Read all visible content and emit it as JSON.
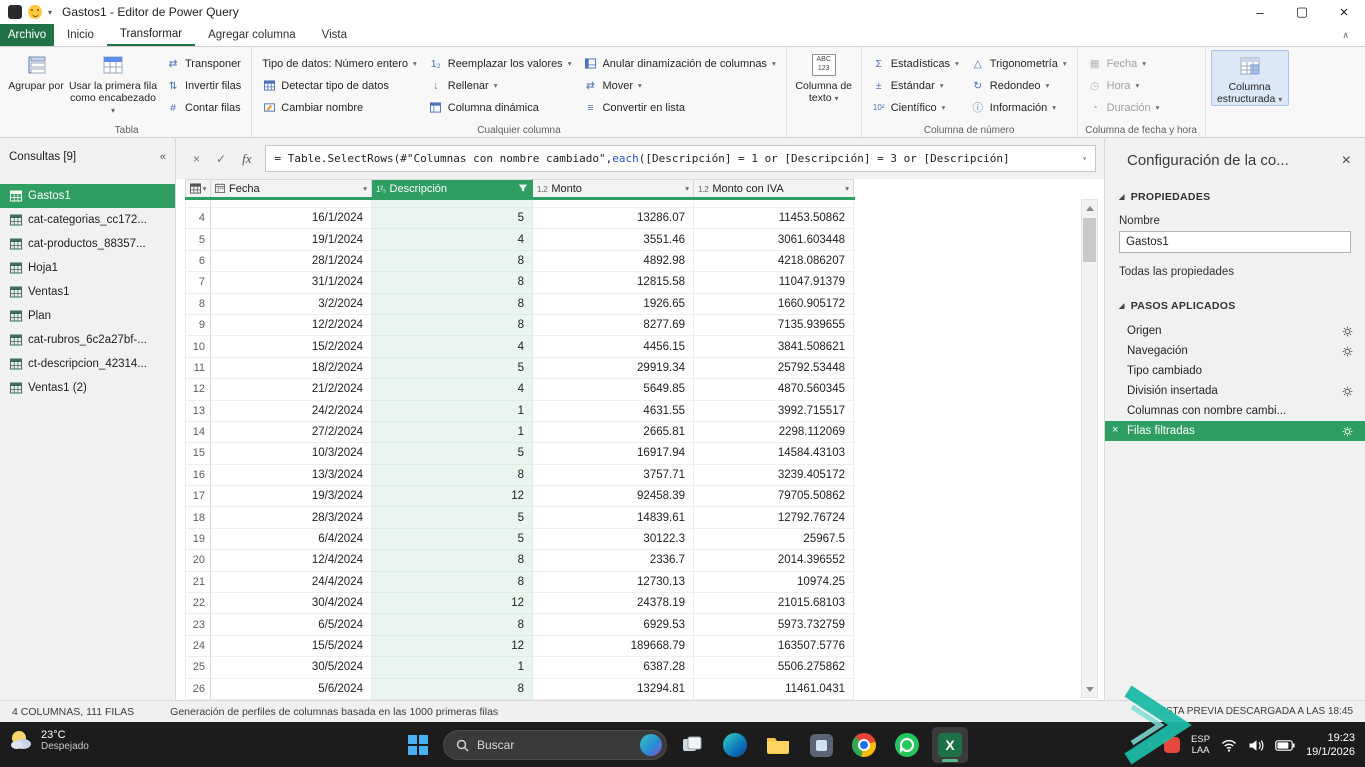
{
  "icons": {
    "dropdown": "▾",
    "collapse_queries": "«",
    "ribbon_collapse": "∧",
    "minimize": "–",
    "maximize": "▢",
    "close": "×",
    "cancel": "×",
    "check": "✓",
    "fx": "fx",
    "swap": "⇄",
    "updown": "⇅",
    "hash": "#",
    "sub12": "1₂",
    "fill": "↓",
    "list": "≡",
    "sigma": "Σ",
    "pm": "±",
    "sci": "10²",
    "tri": "△",
    "round": "↻",
    "info": "ⓘ",
    "cal": "▦",
    "clock": "◷",
    "dur": "◔",
    "type_whole": "1²₃",
    "type_decimal": "1.2",
    "tray_chevron": "∧"
  },
  "window": {
    "title": "Gastos1 - Editor de Power Query"
  },
  "ribbon_tabs": {
    "archivo": "Archivo",
    "inicio": "Inicio",
    "transformar": "Transformar",
    "agregar_columna": "Agregar columna",
    "vista": "Vista"
  },
  "ribbon": {
    "tabla": {
      "label": "Tabla",
      "agrupar_por": "Agrupar por",
      "primera_fila": "Usar la primera fila como encabezado",
      "transponer": "Transponer",
      "invertir_filas": "Invertir filas",
      "contar_filas": "Contar filas"
    },
    "cualquier_columna": {
      "label": "Cualquier columna",
      "tipo_datos": "Tipo de datos: Número entero",
      "detectar_tipo": "Detectar tipo de datos",
      "cambiar_nombre": "Cambiar nombre",
      "reemplazar_valores": "Reemplazar los valores",
      "rellenar": "Rellenar",
      "columna_dinamica": "Columna dinámica",
      "anular_dinamizacion": "Anular dinamización de columnas",
      "mover": "Mover",
      "convertir_lista": "Convertir en lista"
    },
    "columna_texto": {
      "label": "Columna de texto",
      "icon_top": "ABC",
      "icon_bottom": "123"
    },
    "columna_numero": {
      "label": "Columna de número",
      "estadisticas": "Estadísticas",
      "estandar": "Estándar",
      "cientifico": "Científico",
      "trigonometria": "Trigonometría",
      "redondeo": "Redondeo",
      "informacion": "Información"
    },
    "fecha_hora": {
      "label": "Columna de fecha y hora",
      "fecha": "Fecha",
      "hora": "Hora",
      "duracion": "Duración"
    },
    "estructurada": {
      "label": "Columna estructurada"
    }
  },
  "sidebar": {
    "header": "Consultas [9]",
    "items": [
      {
        "label": "Gastos1",
        "selected": true
      },
      {
        "label": "cat-categorias_cc172..."
      },
      {
        "label": "cat-productos_88357..."
      },
      {
        "label": "Hoja1"
      },
      {
        "label": "Ventas1"
      },
      {
        "label": "Plan"
      },
      {
        "label": "cat-rubros_6c2a27bf-..."
      },
      {
        "label": "ct-descripcion_42314..."
      },
      {
        "label": "Ventas1 (2)"
      }
    ]
  },
  "formula_bar": {
    "part1": "= Table.SelectRows(#\"Columnas con nombre cambiado\", ",
    "keyword": "each",
    "part2": " ([Descripción] = 1 or [Descripción] = 3 or [Descripción]"
  },
  "table": {
    "columns": [
      {
        "name": "Fecha"
      },
      {
        "name": "Descripción",
        "selected": true,
        "filtered": true
      },
      {
        "name": "Monto"
      },
      {
        "name": "Monto con IVA"
      }
    ],
    "rows": [
      [
        "4",
        "16/1/2024",
        "5",
        "13286.07",
        "11453.50862"
      ],
      [
        "5",
        "19/1/2024",
        "4",
        "3551.46",
        "3061.603448"
      ],
      [
        "6",
        "28/1/2024",
        "8",
        "4892.98",
        "4218.086207"
      ],
      [
        "7",
        "31/1/2024",
        "8",
        "12815.58",
        "11047.91379"
      ],
      [
        "8",
        "3/2/2024",
        "8",
        "1926.65",
        "1660.905172"
      ],
      [
        "9",
        "12/2/2024",
        "8",
        "8277.69",
        "7135.939655"
      ],
      [
        "10",
        "15/2/2024",
        "4",
        "4456.15",
        "3841.508621"
      ],
      [
        "11",
        "18/2/2024",
        "5",
        "29919.34",
        "25792.53448"
      ],
      [
        "12",
        "21/2/2024",
        "4",
        "5649.85",
        "4870.560345"
      ],
      [
        "13",
        "24/2/2024",
        "1",
        "4631.55",
        "3992.715517"
      ],
      [
        "14",
        "27/2/2024",
        "1",
        "2665.81",
        "2298.112069"
      ],
      [
        "15",
        "10/3/2024",
        "5",
        "16917.94",
        "14584.43103"
      ],
      [
        "16",
        "13/3/2024",
        "8",
        "3757.71",
        "3239.405172"
      ],
      [
        "17",
        "19/3/2024",
        "12",
        "92458.39",
        "79705.50862"
      ],
      [
        "18",
        "28/3/2024",
        "5",
        "14839.61",
        "12792.76724"
      ],
      [
        "19",
        "6/4/2024",
        "5",
        "30122.3",
        "25967.5"
      ],
      [
        "20",
        "12/4/2024",
        "8",
        "2336.7",
        "2014.396552"
      ],
      [
        "21",
        "24/4/2024",
        "8",
        "12730.13",
        "10974.25"
      ],
      [
        "22",
        "30/4/2024",
        "12",
        "24378.19",
        "21015.68103"
      ],
      [
        "23",
        "6/5/2024",
        "8",
        "6929.53",
        "5973.732759"
      ],
      [
        "24",
        "15/5/2024",
        "12",
        "189668.79",
        "163507.5776"
      ],
      [
        "25",
        "30/5/2024",
        "1",
        "6387.28",
        "5506.275862"
      ],
      [
        "26",
        "5/6/2024",
        "8",
        "13294.81",
        "11461.0431"
      ]
    ]
  },
  "right_panel": {
    "title": "Configuración de la co...",
    "propiedades_header": "PROPIEDADES",
    "nombre_label": "Nombre",
    "nombre_value": "Gastos1",
    "todas_link": "Todas las propiedades",
    "pasos_header": "PASOS APLICADOS",
    "steps": [
      {
        "label": "Origen",
        "gear": true
      },
      {
        "label": "Navegación",
        "gear": true
      },
      {
        "label": "Tipo cambiado",
        "gear": false
      },
      {
        "label": "División insertada",
        "gear": true
      },
      {
        "label": "Columnas con nombre cambi...",
        "gear": false
      },
      {
        "label": "Filas filtradas",
        "gear": true,
        "selected": true
      }
    ]
  },
  "status_bar": {
    "left1": "4 COLUMNAS, 111 FILAS",
    "left2": "Generación de perfiles de columnas basada en las 1000 primeras filas",
    "right": "VISTA PREVIA DESCARGADA A LAS 18:45"
  },
  "taskbar": {
    "weather_temp": "23°C",
    "weather_desc": "Despejado",
    "search_placeholder": "Buscar",
    "tray_lang1": "ESP",
    "tray_lang2": "LAA",
    "time": "19:23",
    "date": "19/1/2026"
  }
}
